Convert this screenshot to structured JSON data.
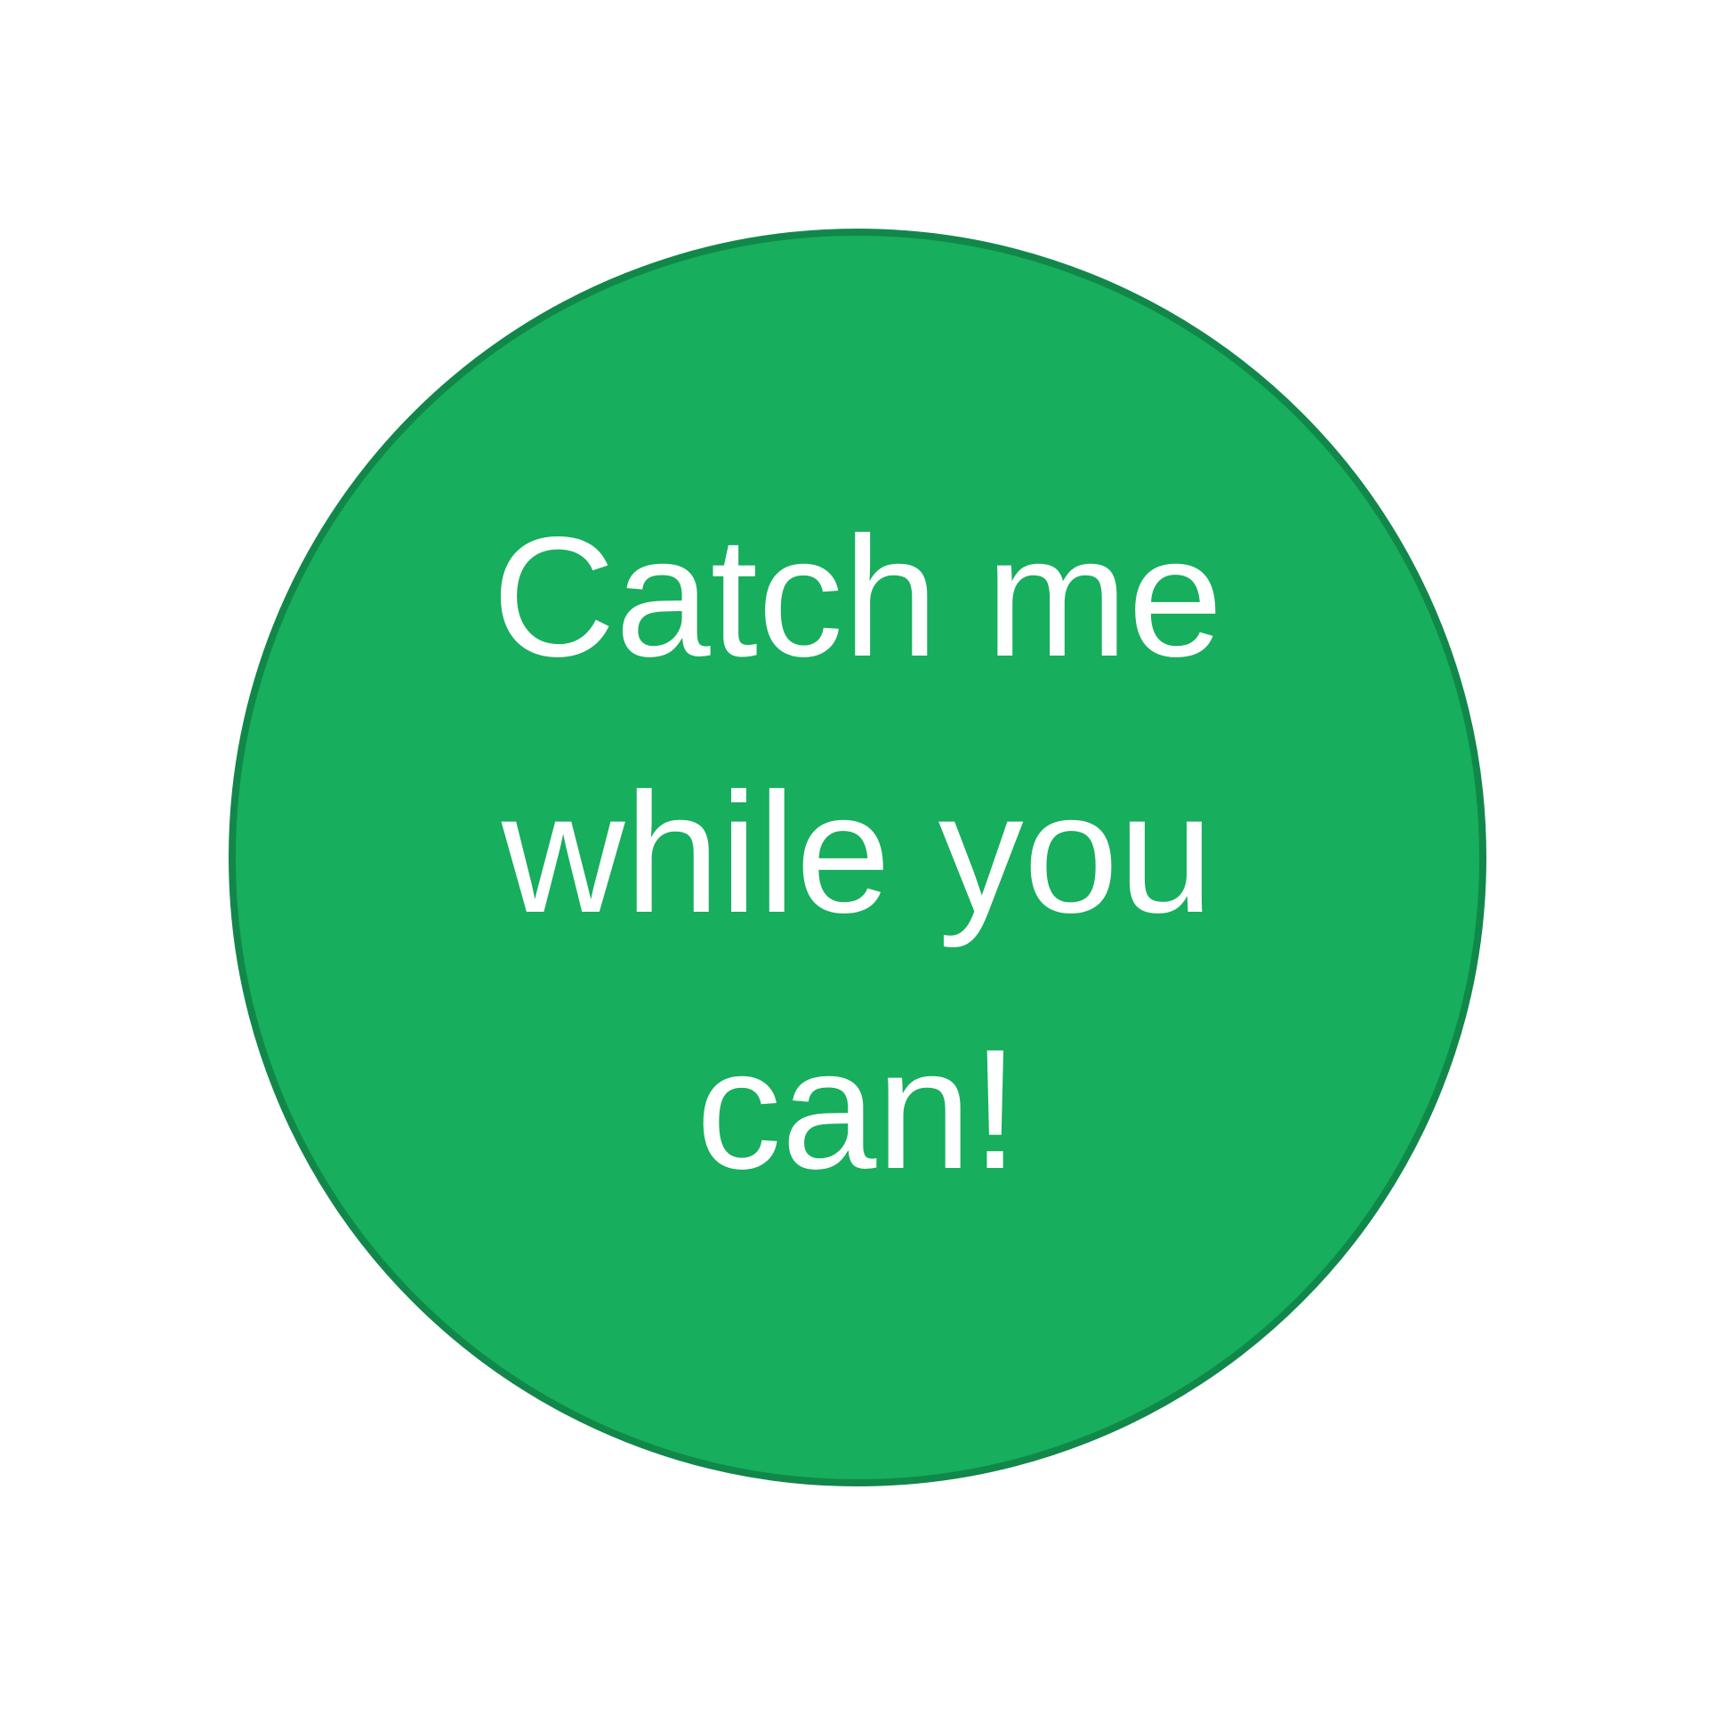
{
  "button": {
    "lines": [
      "Catch me",
      "while you",
      "can!"
    ],
    "background_color": "#17ae5d",
    "border_color": "#11884a",
    "text_color": "#ffffff"
  },
  "page": {
    "background_color": "#ffffff"
  }
}
